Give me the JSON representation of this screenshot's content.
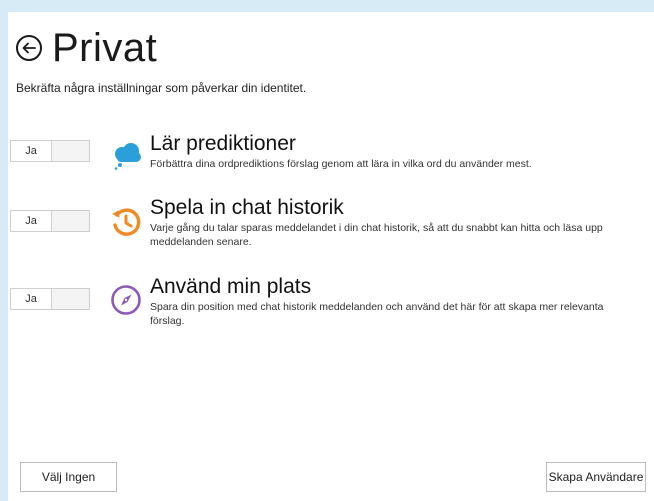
{
  "header": {
    "title": "Privat",
    "subtitle": "Bekräfta några inställningar som påverkar din identitet."
  },
  "settings": [
    {
      "toggle_value": "Ja",
      "icon": "cloud-icon",
      "title": "Lär prediktioner",
      "description": "Förbättra dina ordprediktions förslag genom att lära in vilka ord du använder mest."
    },
    {
      "toggle_value": "Ja",
      "icon": "history-icon",
      "title": "Spela in chat historik",
      "description": "Varje gång du talar sparas meddelandet i din chat historik, så att du snabbt kan hitta och läsa upp meddelanden senare."
    },
    {
      "toggle_value": "Ja",
      "icon": "compass-icon",
      "title": "Använd min plats",
      "description": "Spara din position med chat historik meddelanden och använd det här för att skapa mer relevanta förslag."
    }
  ],
  "footer": {
    "select_none_label": "Välj Ingen",
    "create_user_label": "Skapa Användare"
  },
  "colors": {
    "cloud": "#2b9fd9",
    "history": "#f08a24",
    "compass": "#8e5bb8",
    "background": "#d6ebf5"
  }
}
